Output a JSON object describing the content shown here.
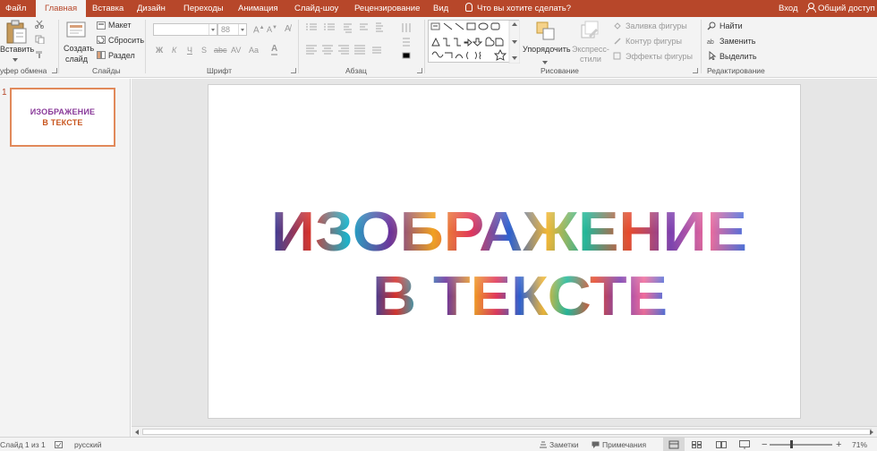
{
  "colors": {
    "accent": "#b7472a",
    "ribbon_bg": "#f3f3f3",
    "workspace_bg": "#e6e6e6",
    "thumb_border": "#e1895a"
  },
  "tabs": [
    {
      "label": "Файл"
    },
    {
      "label": "Главная",
      "active": true
    },
    {
      "label": "Вставка"
    },
    {
      "label": "Дизайн"
    },
    {
      "label": "Переходы"
    },
    {
      "label": "Анимация"
    },
    {
      "label": "Слайд-шоу"
    },
    {
      "label": "Рецензирование"
    },
    {
      "label": "Вид"
    }
  ],
  "tell_me": "Что вы хотите сделать?",
  "account": {
    "sign_in": "Вход",
    "share": "Общий доступ"
  },
  "clipboard": {
    "paste": "Вставить",
    "group": "уфер обмена"
  },
  "slides_group": {
    "new_slide_1": "Создать",
    "new_slide_2": "слайд",
    "layout": "Макет",
    "reset": "Сбросить",
    "section": "Раздел",
    "group": "Слайды"
  },
  "font_group": {
    "font_name": "",
    "font_size": "88",
    "bold": "Ж",
    "italic": "К",
    "underline": "Ч",
    "strike": "S",
    "shadow": "abc",
    "spacing": "AV",
    "case": "Aa",
    "group": "Шрифт"
  },
  "paragraph_group": {
    "group": "Абзац"
  },
  "drawing_group": {
    "arrange": "Упорядочить",
    "styles_1": "Экспресс-",
    "styles_2": "стили",
    "fill": "Заливка фигуры",
    "outline": "Контур фигуры",
    "effects": "Эффекты фигуры",
    "group": "Рисование"
  },
  "editing_group": {
    "find": "Найти",
    "replace": "Заменить",
    "select": "Выделить",
    "group": "Редактирование"
  },
  "thumbnail": {
    "number": "1",
    "line1": "ИЗОБРАЖЕНИЕ",
    "line2": "В ТЕКСТЕ"
  },
  "slide": {
    "line1": "ИЗОБРАЖЕНИЕ",
    "line2": "В ТЕКСТЕ"
  },
  "status": {
    "slide_info": "Слайд 1 из 1",
    "language": "русский",
    "notes": "Заметки",
    "comments": "Примечания",
    "zoom": "71%"
  }
}
